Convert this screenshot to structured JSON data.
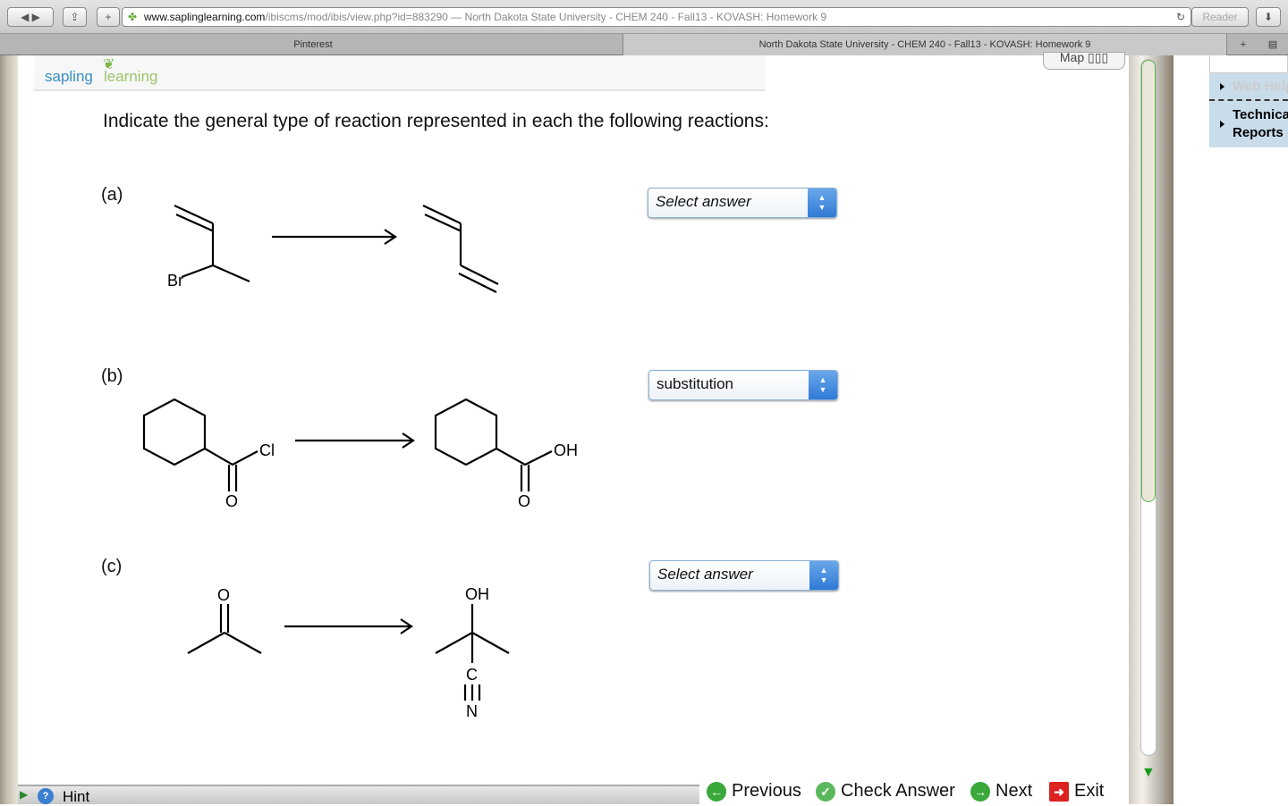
{
  "browser": {
    "url_host": "www.saplinglearning.com",
    "url_path": "/ibiscms/mod/ibis/view.php?id=883290",
    "url_title": " — North Dakota State University - CHEM 240 - Fall13 - KOVASH: Homework 9",
    "reader_label": "Reader",
    "tabs": [
      {
        "label": "Pinterest"
      },
      {
        "label": "North Dakota State University - CHEM 240 - Fall13 - KOVASH: Homework 9"
      }
    ]
  },
  "logo": {
    "text1": "sapling",
    "text2": "learning"
  },
  "map_label": "Map",
  "sidebar": {
    "items": [
      {
        "label": "Web Help"
      },
      {
        "label": "Technical Reports"
      }
    ]
  },
  "question": "Indicate the general type of reaction represented in each the following reactions:",
  "parts": [
    {
      "label": "(a)",
      "selected": "Select answer",
      "atoms": {
        "br": "Br"
      }
    },
    {
      "label": "(b)",
      "selected": "substitution",
      "atoms": {
        "cl": "Cl",
        "o1": "O",
        "oh": "OH",
        "o2": "O"
      }
    },
    {
      "label": "(c)",
      "selected": "Select answer",
      "atoms": {
        "o": "O",
        "oh": "OH",
        "c": "C",
        "n": "N"
      }
    }
  ],
  "footer": {
    "hint": "Hint",
    "previous": "Previous",
    "check": "Check Answer",
    "next": "Next",
    "exit": "Exit"
  }
}
